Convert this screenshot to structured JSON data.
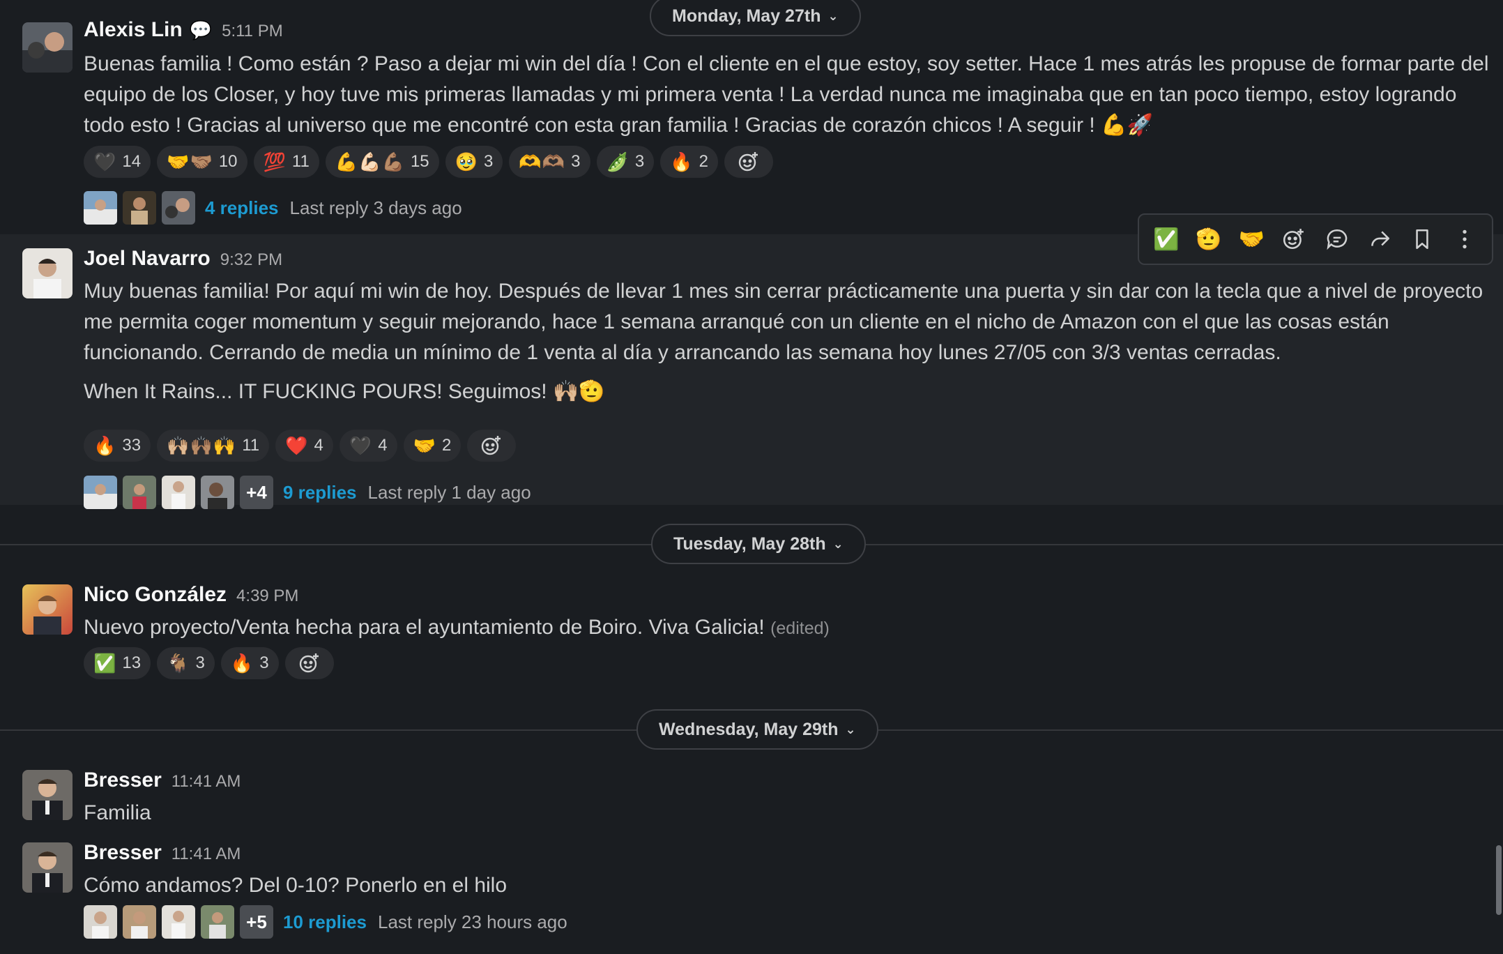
{
  "dates": {
    "d1": "Monday, May 27th",
    "d2": "Tuesday, May 28th",
    "d3": "Wednesday, May 29th"
  },
  "messages": [
    {
      "author": "Alexis Lin",
      "status": "💬",
      "time": "5:11 PM",
      "text": "Buenas familia ! Como están ? Paso a dejar mi win del día ! Con el cliente en el que estoy, soy setter. Hace 1 mes atrás les propuse de formar parte del equipo de los Closer, y hoy tuve mis primeras llamadas y mi primera venta ! La verdad nunca me imaginaba que en tan poco tiempo, estoy logrando todo esto ! Gracias al universo que me encontré con esta gran familia ! Gracias de corazón chicos !  A seguir ! 💪🚀",
      "reactions": [
        {
          "emoji": "🖤",
          "count": "14"
        },
        {
          "emoji": "🤝🤝🏽",
          "count": "10"
        },
        {
          "emoji": "💯",
          "count": "11"
        },
        {
          "emoji": "💪💪🏻💪🏽",
          "count": "15"
        },
        {
          "emoji": "🥹",
          "count": "3"
        },
        {
          "emoji": "🫶🫶🏽",
          "count": "3"
        },
        {
          "emoji": "🫛",
          "count": "3"
        },
        {
          "emoji": "🔥",
          "count": "2"
        }
      ],
      "replies": "4 replies",
      "last_reply": "Last reply 3 days ago"
    },
    {
      "author": "Joel Navarro",
      "time": "9:32 PM",
      "text": "Muy buenas familia! Por aquí mi win de hoy. Después de llevar 1 mes sin cerrar prácticamente una puerta y sin dar con la tecla que a nivel de proyecto me permita coger momentum y seguir mejorando, hace 1 semana arranqué con un cliente en el nicho de Amazon con el que las cosas están funcionando. Cerrando de media un mínimo de 1 venta al día y arrancando las semana hoy lunes 27/05 con 3/3 ventas cerradas.",
      "text2": "When It Rains... IT FUCKING POURS! Seguimos! 🙌🏼🫡",
      "reactions": [
        {
          "emoji": "🔥",
          "count": "33"
        },
        {
          "emoji": "🙌🏼🙌🏽🙌",
          "count": "11"
        },
        {
          "emoji": "❤️",
          "count": "4"
        },
        {
          "emoji": "🖤",
          "count": "4"
        },
        {
          "emoji": "🤝",
          "count": "2"
        }
      ],
      "more": "+4",
      "replies": "9 replies",
      "last_reply": "Last reply 1 day ago"
    },
    {
      "author": "Nico González",
      "time": "4:39 PM",
      "text": "Nuevo proyecto/Venta hecha para el ayuntamiento de Boiro. Viva Galicia!",
      "edited": "(edited)",
      "reactions": [
        {
          "emoji": "✅",
          "count": "13"
        },
        {
          "emoji": "🐐",
          "count": "3"
        },
        {
          "emoji": "🔥",
          "count": "3"
        }
      ]
    },
    {
      "author": "Bresser",
      "time": "11:41 AM",
      "text": "Familia"
    },
    {
      "author": "Bresser",
      "time": "11:41 AM",
      "text": "Cómo andamos? Del 0-10? Ponerlo en el hilo",
      "more": "+5",
      "replies": "10 replies",
      "last_reply": "Last reply 23 hours ago"
    }
  ],
  "toolbar": {
    "items": [
      "✅",
      "🫡",
      "🤝"
    ]
  },
  "icons": {
    "add_reaction": "add-reaction-icon",
    "reply_thread": "reply-in-thread-icon",
    "forward": "forward-icon",
    "bookmark": "save-icon",
    "more": "more-actions-icon"
  },
  "colors": {
    "background": "#1a1d21",
    "link": "#1d9bd1",
    "hover": "#222529"
  }
}
